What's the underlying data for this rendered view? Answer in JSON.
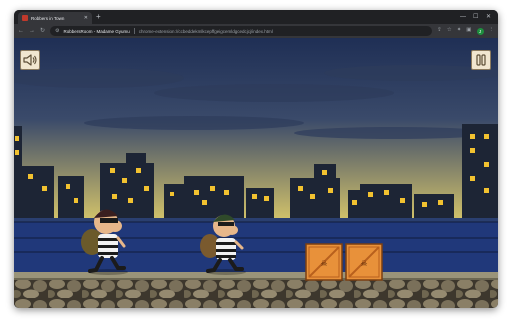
{
  "browser": {
    "tab_title": "Robbers in Town",
    "tab_close": "✕",
    "new_tab": "+",
    "window_controls": {
      "minimize": "—",
      "maximize": "☐",
      "close": "✕"
    },
    "nav": {
      "back": "←",
      "forward": "→",
      "reload": "↻"
    },
    "site_name": "RobbersRoom - Madame Gyumu",
    "url": "chrome-extension://ccbeddekmlkcepffgeigcemldgcedcjcj/index.html",
    "profile_initial": "J"
  },
  "game": {
    "title": "Robbers in Town",
    "buttons": {
      "sound_icon": "speaker-icon",
      "pause_icon": "pause-icon"
    },
    "crates": 2,
    "robbers": 2,
    "colors": {
      "sky_top": "#1f2f55",
      "sky_horizon": "#cfc06a",
      "buildings": "#1d2535",
      "windows": "#f2c230",
      "water": "#20387a",
      "road": "#9a9479",
      "wall": "#4a4437",
      "crate": "#e8913a"
    }
  }
}
